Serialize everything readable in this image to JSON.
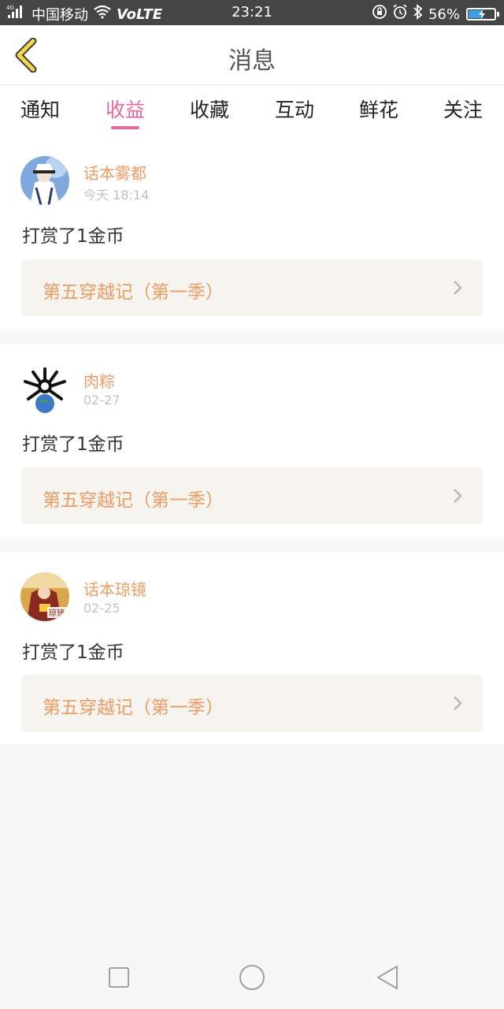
{
  "status_bar": {
    "network_type": "4G",
    "carrier": "中国移动",
    "volte": "VoLTE",
    "time": "23:21",
    "battery_percent": "56%",
    "battery_level": 0.56,
    "icons": [
      "signal-icon",
      "wifi-icon",
      "lock-rotation-icon",
      "alarm-icon",
      "bluetooth-icon",
      "battery-charging-icon"
    ]
  },
  "header": {
    "title": "消息",
    "back_icon": "chevron-left-icon"
  },
  "tabs": [
    {
      "label": "通知",
      "active": false
    },
    {
      "label": "收益",
      "active": true
    },
    {
      "label": "收藏",
      "active": false
    },
    {
      "label": "互动",
      "active": false
    },
    {
      "label": "鲜花",
      "active": false
    },
    {
      "label": "关注",
      "active": false
    }
  ],
  "messages": [
    {
      "user": "话本雾都",
      "time": "今天 18:14",
      "action": "打赏了1金币",
      "book": "第五穿越记（第一季）"
    },
    {
      "user": "肉粽",
      "time": "02-27",
      "action": "打赏了1金币",
      "book": "第五穿越记（第一季）"
    },
    {
      "user": "话本琼镜",
      "time": "02-25",
      "action": "打赏了1金币",
      "book": "第五穿越记（第一季）"
    }
  ],
  "avatar_badge_text": "琼镜",
  "nav_bar": {
    "icons": [
      "recent-apps-icon",
      "home-icon",
      "back-triangle-icon"
    ]
  },
  "colors": {
    "accent_pink": "#e8679e",
    "orange_text": "#ef9b63",
    "status_bar_bg": "#454545",
    "back_arrow": "#f0d84a"
  }
}
